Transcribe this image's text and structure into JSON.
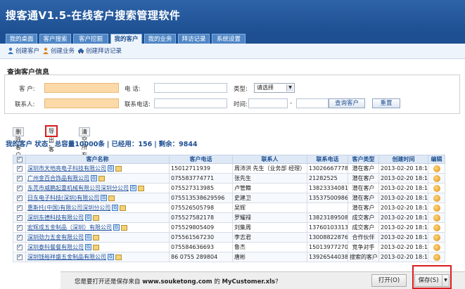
{
  "app": {
    "title": "搜客通V1.5-在线客户搜索管理软件"
  },
  "tabs": [
    {
      "label": "我的桌面"
    },
    {
      "label": "客户搜索"
    },
    {
      "label": "客户挖掘"
    },
    {
      "label": "我的客户"
    },
    {
      "label": "我的业务"
    },
    {
      "label": "拜访记录"
    },
    {
      "label": "系统设置"
    }
  ],
  "active_tab": "我的客户",
  "toolbar": {
    "create_customer": "创建客户",
    "create_business": "创建业务",
    "create_visit": "创建拜访记录"
  },
  "query": {
    "section_title": "查询客户信息",
    "customer_label": "客    户:",
    "phone_label": "电    话:",
    "type_label": "类型:",
    "type_value": "请选择",
    "contact_label": "联系人:",
    "contact_phone_label": "联系电话:",
    "time_label": "时间:",
    "time_sep": "-",
    "search_button": "查询客户",
    "reset_button": "重置"
  },
  "actions": {
    "delete": "删除客户",
    "export": "导出客户",
    "clear": "清空所有"
  },
  "status": {
    "text": "我的客户 状态：总容量10000条",
    "used": "已经用：156",
    "remaining": "剩余：9844"
  },
  "table": {
    "columns": [
      "客户名称",
      "客户电话",
      "联系人",
      "联系电话",
      "客户类型",
      "创建时间",
      "编辑"
    ],
    "rows": [
      {
        "name": "深圳市天地亮电子科技有限公司",
        "phone": "15012711939",
        "contact": "周沛洪 先生（业务部 经理）",
        "contact_phone": "13026667778",
        "type": "潜在客户",
        "created": "2013-02-20 18:16:47"
      },
      {
        "name": "广州金百合饰品有限公司",
        "phone": "075583774771",
        "contact": "张先生",
        "contact_phone": "21282525",
        "type": "潜在客户",
        "created": "2013-02-20 18:16:47"
      },
      {
        "name": "东莞市威鹏起重机械有限公司深圳分公司",
        "phone": "075527313985",
        "contact": "卢管籍",
        "contact_phone": "13823334081",
        "type": "潜在客户",
        "created": "2013-02-20 18:16:46"
      },
      {
        "name": "日东电子科技(深圳)有限公司",
        "phone": "075513538629596",
        "contact": "史建卫",
        "contact_phone": "13537500986",
        "type": "潜在客户",
        "created": "2013-02-20 18:16:45"
      },
      {
        "name": "惠斯托(中国)有限公司深圳分公司",
        "phone": "075526505798",
        "contact": "吴辉",
        "contact_phone": "",
        "type": "潜在客户",
        "created": "2013-02-20 18:16:44"
      },
      {
        "name": "深圳东德科技有限公司",
        "phone": "075527582178",
        "contact": "罗耀禄",
        "contact_phone": "13823189508",
        "type": "成交客户",
        "created": "2013-02-20 18:16:43"
      },
      {
        "name": "宏辉成五金制品（深圳）有限公司",
        "phone": "075529805409",
        "contact": "刘集周",
        "contact_phone": "13760103313",
        "type": "成交客户",
        "created": "2013-02-20 18:16:43"
      },
      {
        "name": "深圳劲力五金有限公司",
        "phone": "075561567230",
        "contact": "李志君",
        "contact_phone": "13008822876",
        "type": "合作伙伴",
        "created": "2013-02-20 18:16:42"
      },
      {
        "name": "深圳泰科餐餐有限公司",
        "phone": "075584636693",
        "contact": "鲁杰",
        "contact_phone": "15013977270",
        "type": "竞争对手",
        "created": "2013-02-20 18:16:41"
      },
      {
        "name": "深圳钱裕祥盛五金制品有限公司",
        "phone": "86 0755 289804",
        "contact": "唐彬",
        "contact_phone": "13926544038",
        "type": "搜索的客户",
        "created": "2013-02-20 18:16:40"
      }
    ]
  },
  "download_bar": {
    "prompt": "您是要打开还是保存来自",
    "site": "www.souketong.com",
    "mid": "的",
    "file": "MyCustomer.xls",
    "suffix": "?",
    "open_button": "打开(O)",
    "save_button": "保存(S)"
  },
  "colors": {
    "header_blue": "#1d4f92",
    "highlight_input": "#fcd9a8",
    "annotation_red": "#d81e1e"
  }
}
